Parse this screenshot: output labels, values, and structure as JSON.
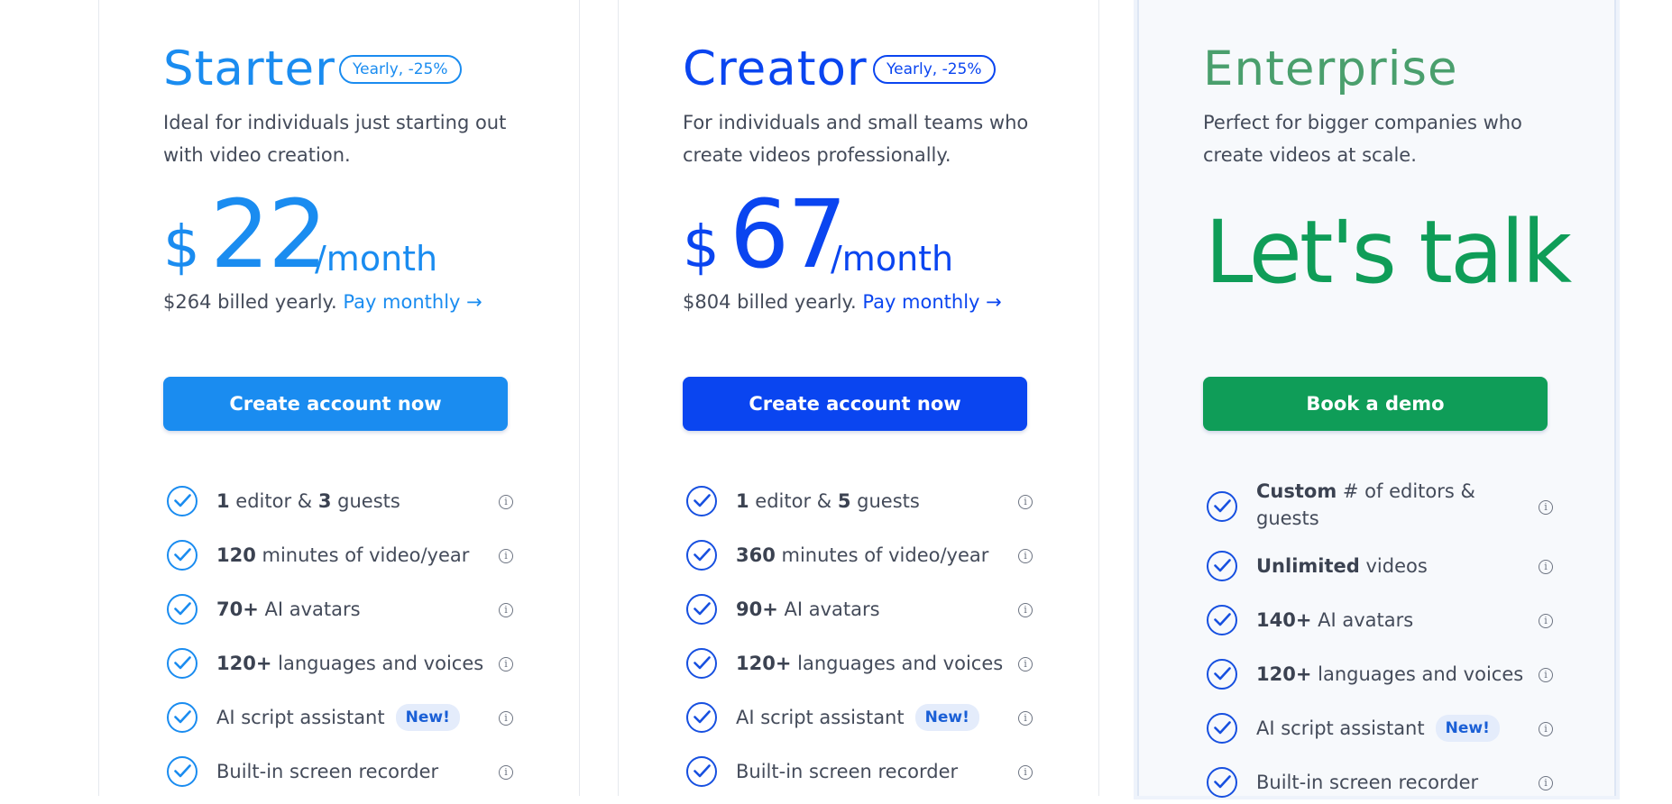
{
  "colors": {
    "starter_accent": "#1a8cf0",
    "creator_accent": "#0a45f0",
    "enterprise_title": "#4a9f6d",
    "enterprise_accent": "#0f9d58",
    "check_blue": "#1750e0"
  },
  "plans": [
    {
      "title": "Starter",
      "badge": "Yearly, -25%",
      "description": "Ideal for individuals just starting out with video creation.",
      "currency": "$",
      "price": "22",
      "per": "/month",
      "billed": "$264 billed yearly.",
      "pay_link": "Pay monthly →",
      "cta": "Create account now",
      "features": [
        {
          "b1": "1",
          "t1": " editor & ",
          "b2": "3",
          "t2": " guests",
          "info": "i"
        },
        {
          "b1": "120",
          "t1": " minutes of video/year",
          "info": "i"
        },
        {
          "b1": "70+",
          "t1": " AI avatars",
          "info": "i"
        },
        {
          "b1": "120+",
          "t1": " languages and voices",
          "info": "i"
        },
        {
          "t1": "AI script assistant",
          "tag": "New!",
          "info": "i"
        },
        {
          "t1": "Built-in screen recorder",
          "info": "i"
        }
      ]
    },
    {
      "title": "Creator",
      "badge": "Yearly, -25%",
      "description": "For individuals and small teams who create videos professionally.",
      "currency": "$",
      "price": "67",
      "per": "/month",
      "billed": "$804 billed yearly.",
      "pay_link": "Pay monthly →",
      "cta": "Create account now",
      "features": [
        {
          "b1": "1",
          "t1": " editor & ",
          "b2": "5",
          "t2": " guests",
          "info": "i"
        },
        {
          "b1": "360",
          "t1": " minutes of video/year",
          "info": "i"
        },
        {
          "b1": "90+",
          "t1": " AI avatars",
          "info": "i"
        },
        {
          "b1": "120+",
          "t1": " languages and voices",
          "info": "i"
        },
        {
          "t1": "AI script assistant",
          "tag": "New!",
          "info": "i"
        },
        {
          "t1": "Built-in screen recorder",
          "info": "i"
        }
      ]
    },
    {
      "title": "Enterprise",
      "description": "Perfect for bigger companies who create videos at scale.",
      "headline": "Let's talk",
      "cta": "Book a demo",
      "features": [
        {
          "b1": "Custom",
          "t1": " # of editors & guests",
          "info": "i"
        },
        {
          "b1": "Unlimited",
          "t1": " videos",
          "info": "i"
        },
        {
          "b1": "140+",
          "t1": " AI avatars",
          "info": "i"
        },
        {
          "b1": "120+",
          "t1": " languages and voices",
          "info": "i"
        },
        {
          "t1": "AI script assistant",
          "tag": "New!",
          "info": "i"
        },
        {
          "t1": "Built-in screen recorder",
          "info": "i"
        }
      ]
    }
  ]
}
